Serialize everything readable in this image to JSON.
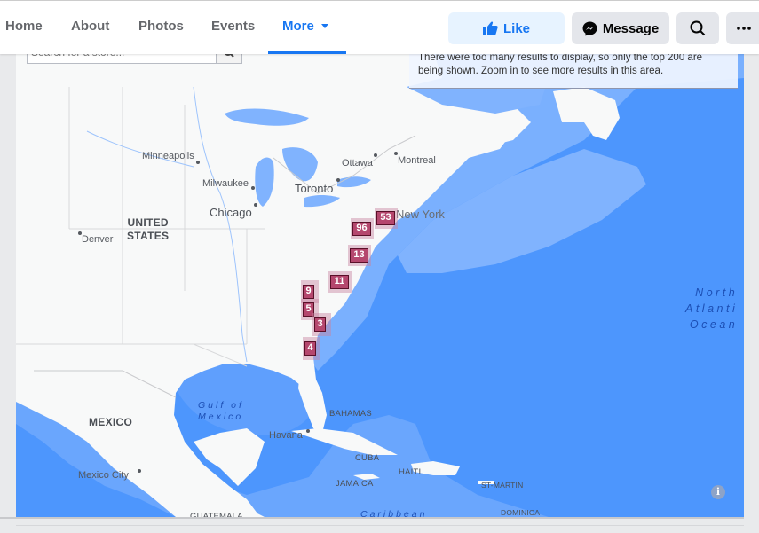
{
  "nav": {
    "tabs": [
      {
        "label": "Home",
        "active": false
      },
      {
        "label": "About",
        "active": false
      },
      {
        "label": "Photos",
        "active": false
      },
      {
        "label": "Events",
        "active": false
      },
      {
        "label": "More",
        "active": true
      }
    ],
    "actions": {
      "like_label": "Like",
      "message_label": "Message",
      "search_icon": "search-icon",
      "more_icon": "ellipsis-icon"
    },
    "accent_color": "#1877f2"
  },
  "store_search": {
    "placeholder": "Search for a store...",
    "value": ""
  },
  "notice": {
    "text": "There were too many results to display, so only the top 200 are being shown. Zoom in to see more results in this area."
  },
  "map": {
    "labels": {
      "minneapolis": "Minneapolis",
      "milwaukee": "Milwaukee",
      "chicago": "Chicago",
      "denver": "Denver",
      "toronto": "Toronto",
      "ottawa": "Ottawa",
      "montreal": "Montreal",
      "new_york": "New York",
      "united_states_1": "UNITED",
      "united_states_2": "STATES",
      "mexico": "MEXICO",
      "mexico_city": "Mexico City",
      "havana": "Havana",
      "bahamas": "BAHAMAS",
      "cuba": "CUBA",
      "haiti": "HAITI",
      "jamaica": "JAMAICA",
      "st_martin": "ST-MARTIN",
      "dominica": "DOMINICA",
      "guatemala": "GUATEMALA",
      "gulf_1": "Gulf of",
      "gulf_2": "Mexico",
      "ocean_1": "North",
      "ocean_2": "Atlanti",
      "ocean_3": "Ocean",
      "caribbean": "Caribbean"
    },
    "clusters": [
      {
        "id": "new-york",
        "count": "53"
      },
      {
        "id": "pennsylvania",
        "count": "96"
      },
      {
        "id": "maryland",
        "count": "13"
      },
      {
        "id": "virginia",
        "count": "11"
      },
      {
        "id": "north-carolina-west",
        "count": "9"
      },
      {
        "id": "north-carolina-south",
        "count": "5"
      },
      {
        "id": "south-carolina",
        "count": "3"
      },
      {
        "id": "georgia",
        "count": "4"
      }
    ],
    "cluster_color": "#b5476e",
    "water_color": "#4d96fd",
    "info_icon": "i"
  }
}
